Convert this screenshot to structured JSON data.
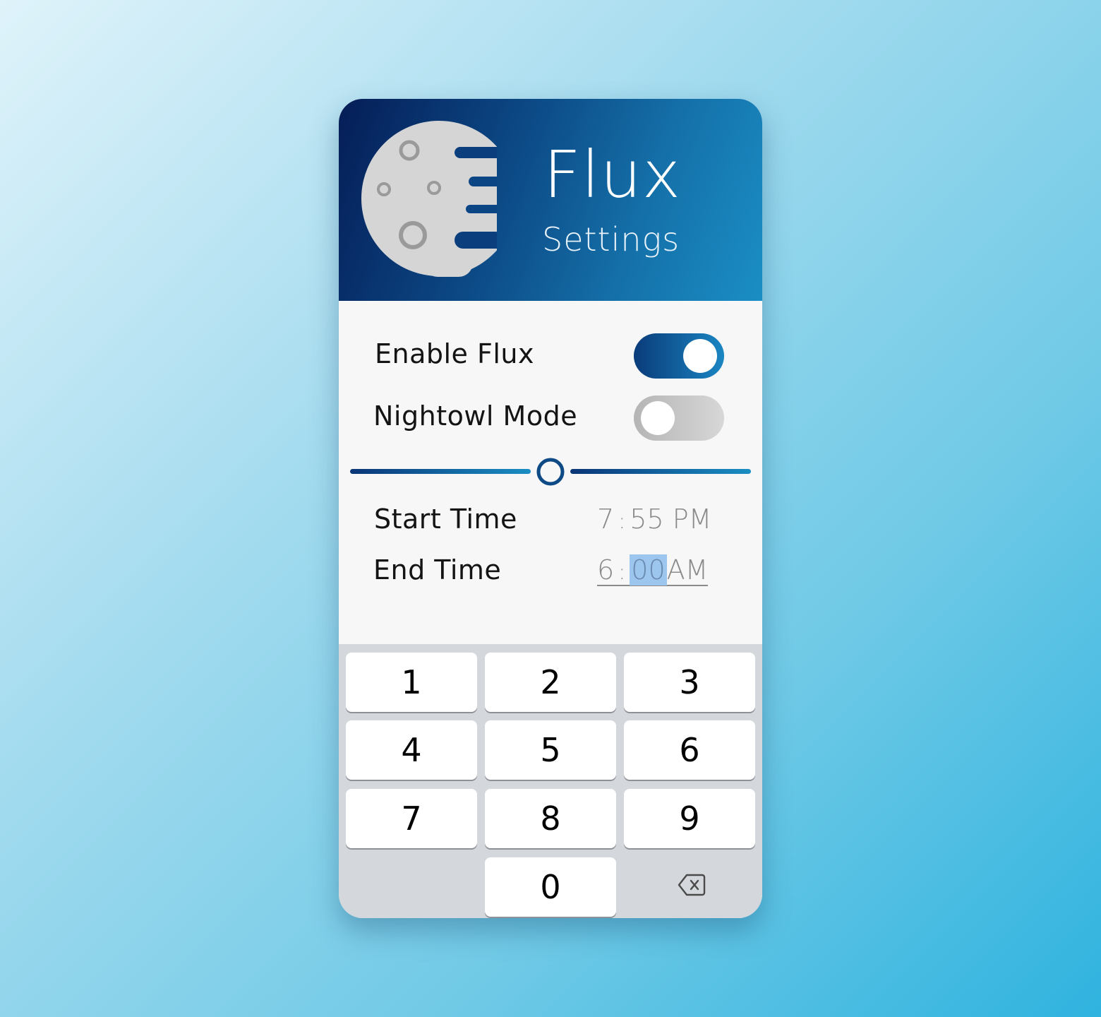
{
  "app": {
    "title": "Flux",
    "subtitle": "Settings",
    "logo_icon": "moon-flux-logo-icon"
  },
  "colors": {
    "header_start": "#051d57",
    "header_end": "#1a8ec4",
    "toggle_on": "#0a3b7a",
    "toggle_off": "#b5b5b5",
    "selection": "#9cc6ee",
    "background": "#2fb3df"
  },
  "settings": {
    "enable_flux": {
      "label": "Enable Flux",
      "on": true
    },
    "nightowl_mode": {
      "label": "Nightowl Mode",
      "on": false
    }
  },
  "slider": {
    "value_fraction": 0.5
  },
  "start_time": {
    "label": "Start Time",
    "hour": "7",
    "separator": ":",
    "minute": "55",
    "period": "PM"
  },
  "end_time": {
    "label": "End Time",
    "hour": "6",
    "separator": ":",
    "minute": "00",
    "period": "AM",
    "selected_field": "minute"
  },
  "keypad": {
    "keys": [
      "1",
      "2",
      "3",
      "4",
      "5",
      "6",
      "7",
      "8",
      "9",
      "0"
    ],
    "delete_icon": "backspace-icon"
  }
}
